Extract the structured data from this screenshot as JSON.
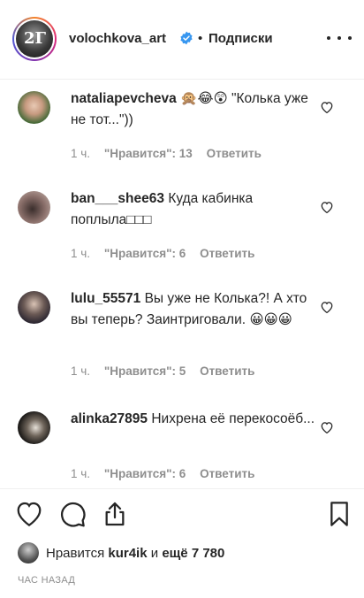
{
  "header": {
    "avatar_text": "2Г",
    "username": "volochkova_art",
    "separator": "•",
    "follow_label": "Подписки"
  },
  "comments": [
    {
      "username": "nataliapevcheva",
      "text": "🙊😂😲 \"Колька уже не тот...\"))",
      "time": "1 ч.",
      "likes": "\"Нравится\": 13",
      "reply": "Ответить",
      "avatar_color": "#4a6b3a"
    },
    {
      "username": "ban___shee63",
      "text": "Куда кабинка поплыла□□□",
      "time": "1 ч.",
      "likes": "\"Нравится\": 6",
      "reply": "Ответить",
      "avatar_color": "#8a6f6a"
    },
    {
      "username": "lulu_55571",
      "text": "Вы уже не Колька?! А хто вы теперь? Заинтриговали. 😀😀😀",
      "time": "1 ч.",
      "likes": "\"Нравится\": 5",
      "reply": "Ответить",
      "avatar_color": "#2a2530"
    },
    {
      "username": "alinka27895",
      "text": "Нихрена её перекосоёб...",
      "time": "1 ч.",
      "likes": "\"Нравится\": 6",
      "reply": "Ответить",
      "avatar_color": "#1c1a18"
    }
  ],
  "footer": {
    "liked_prefix": "Нравится",
    "liked_user": "kur4ik",
    "liked_middle": "и",
    "liked_others": "ещё 7 780",
    "time_ago": "ЧАС НАЗАД"
  }
}
